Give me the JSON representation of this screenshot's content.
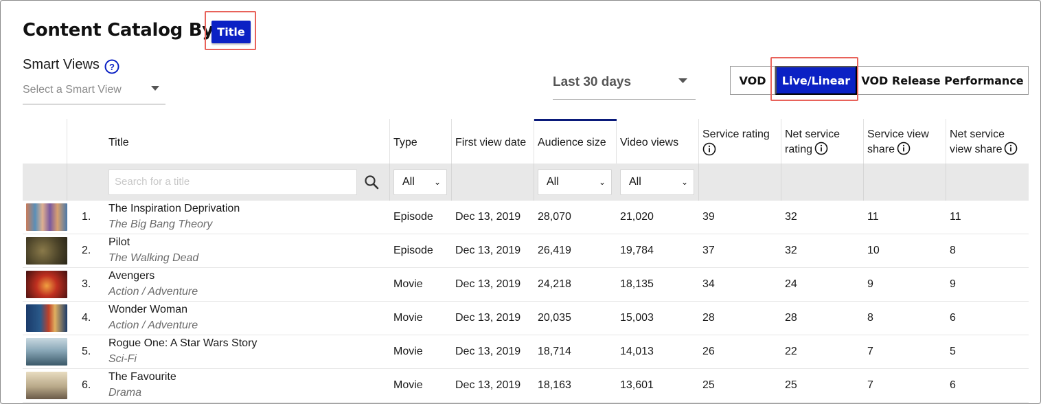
{
  "header": {
    "title": "Content Catalog By",
    "title_toggle": "Title"
  },
  "smart_views": {
    "label": "Smart Views",
    "placeholder": "Select a Smart View"
  },
  "date_range": {
    "value": "Last 30 days"
  },
  "view_modes": [
    {
      "label": "VOD",
      "selected": false
    },
    {
      "label": "Live/Linear",
      "selected": true
    },
    {
      "label": "VOD Release Performance",
      "selected": false
    }
  ],
  "table": {
    "headers": {
      "title": "Title",
      "type": "Type",
      "first_view": "First view date",
      "audience": "Audience size",
      "views": "Video views",
      "svc_rating": "Service rating",
      "net_rating_1": "Net service",
      "net_rating_2": "rating",
      "share_1": "Service view",
      "share_2": "share",
      "net_share_1": "Net service",
      "net_share_2": "view share"
    },
    "filters": {
      "search_placeholder": "Search for a title",
      "type": "All",
      "audience": "All",
      "views": "All"
    },
    "rows": [
      {
        "rank": "1.",
        "title": "The Inspiration Deprivation",
        "subtitle": "The Big Bang Theory",
        "type": "Episode",
        "date": "Dec 13, 2019",
        "audience": "28,070",
        "views": "21,020",
        "svc_rating": "39",
        "net_rating": "32",
        "share": "11",
        "net_share": "11"
      },
      {
        "rank": "2.",
        "title": "Pilot",
        "subtitle": "The Walking Dead",
        "type": "Episode",
        "date": "Dec 13, 2019",
        "audience": "26,419",
        "views": "19,784",
        "svc_rating": "37",
        "net_rating": "32",
        "share": "10",
        "net_share": "8"
      },
      {
        "rank": "3.",
        "title": "Avengers",
        "subtitle": "Action / Adventure",
        "type": "Movie",
        "date": "Dec 13, 2019",
        "audience": "24,218",
        "views": "18,135",
        "svc_rating": "34",
        "net_rating": "24",
        "share": "9",
        "net_share": "9"
      },
      {
        "rank": "4.",
        "title": "Wonder Woman",
        "subtitle": "Action / Adventure",
        "type": "Movie",
        "date": "Dec 13, 2019",
        "audience": "20,035",
        "views": "15,003",
        "svc_rating": "28",
        "net_rating": "28",
        "share": "8",
        "net_share": "6"
      },
      {
        "rank": "5.",
        "title": "Rogue One: A Star Wars Story",
        "subtitle": "Sci-Fi",
        "type": "Movie",
        "date": "Dec 13, 2019",
        "audience": "18,714",
        "views": "14,013",
        "svc_rating": "26",
        "net_rating": "22",
        "share": "7",
        "net_share": "5"
      },
      {
        "rank": "6.",
        "title": "The Favourite",
        "subtitle": "Drama",
        "type": "Movie",
        "date": "Dec 13, 2019",
        "audience": "18,163",
        "views": "13,601",
        "svc_rating": "25",
        "net_rating": "25",
        "share": "7",
        "net_share": "6"
      }
    ]
  },
  "colors": {
    "accent": "#0b21c4",
    "highlight": "#e8625a",
    "sort_bar": "#0a1a7a"
  }
}
